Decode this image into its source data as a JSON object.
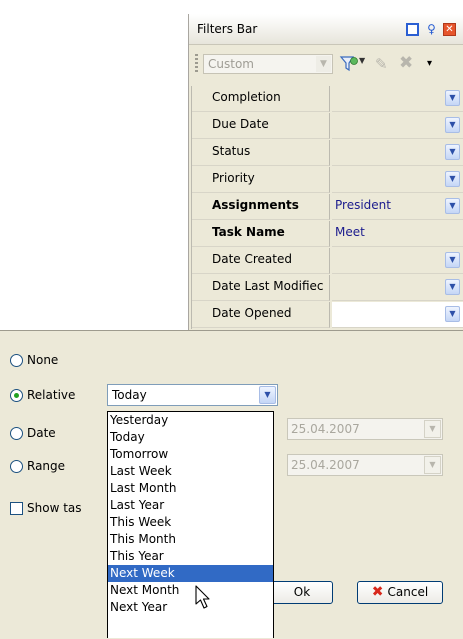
{
  "filters_bar": {
    "title": "Filters Bar",
    "combo_value": "Custom",
    "rows": [
      {
        "name": "Completion",
        "value": "",
        "bold": false,
        "dropdown": true
      },
      {
        "name": "Due Date",
        "value": "",
        "bold": false,
        "dropdown": true
      },
      {
        "name": "Status",
        "value": "",
        "bold": false,
        "dropdown": true
      },
      {
        "name": "Priority",
        "value": "",
        "bold": false,
        "dropdown": true
      },
      {
        "name": "Assignments",
        "value": "President",
        "bold": true,
        "dropdown": true
      },
      {
        "name": "Task Name",
        "value": "Meet",
        "bold": true,
        "dropdown": false
      },
      {
        "name": "Date Created",
        "value": "",
        "bold": false,
        "dropdown": true
      },
      {
        "name": "Date Last Modifiec",
        "value": "",
        "bold": false,
        "dropdown": true
      },
      {
        "name": "Date Opened",
        "value": "",
        "bold": false,
        "dropdown": true,
        "active": true
      }
    ]
  },
  "date_dialog": {
    "options": {
      "none": "None",
      "relative": "Relative",
      "date": "Date",
      "range": "Range"
    },
    "selected_option": "relative",
    "relative_value": "Today",
    "date_value": "25.04.2007",
    "range_end_value": "25.04.2007",
    "show_label": "Show tas",
    "ok_label": "Ok",
    "cancel_label": "Cancel",
    "relative_list": {
      "items": [
        "Yesterday",
        "Today",
        "Tomorrow",
        "Last Week",
        "Last Month",
        "Last Year",
        "This Week",
        "This Month",
        "This Year",
        "Next Week",
        "Next Month",
        "Next Year"
      ],
      "highlighted": "Next Week"
    }
  },
  "colors": {
    "panel_bg": "#ece9d8",
    "selection": "#316ac5",
    "value_text": "#1b1b8d"
  }
}
